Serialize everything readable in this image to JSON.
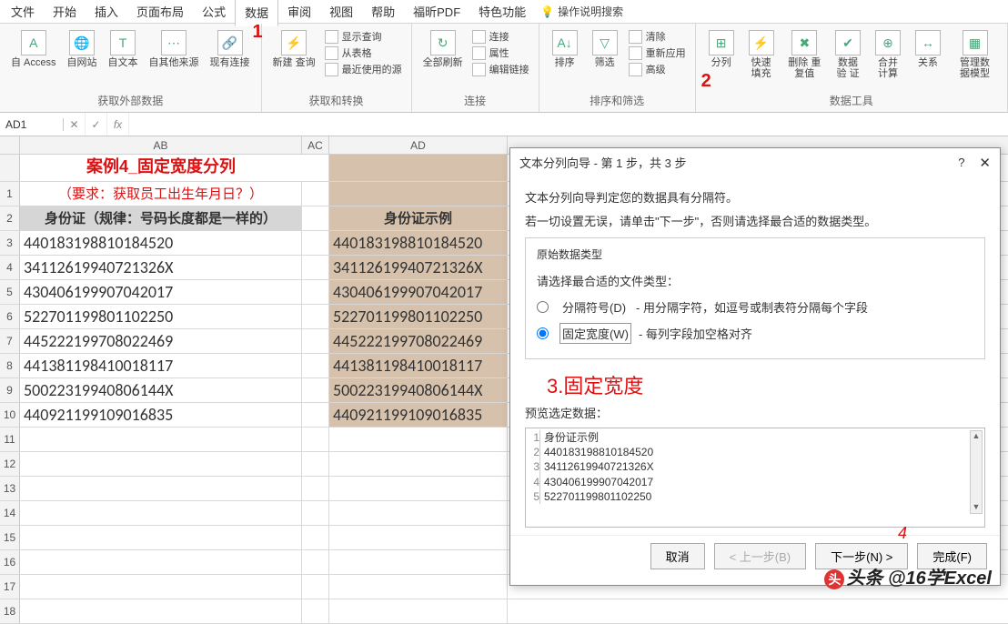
{
  "tabs": [
    "文件",
    "开始",
    "插入",
    "页面布局",
    "公式",
    "数据",
    "审阅",
    "视图",
    "帮助",
    "福昕PDF",
    "特色功能"
  ],
  "active_tab_index": 5,
  "search_help": "操作说明搜索",
  "ribbon": {
    "groups": [
      {
        "label": "获取外部数据",
        "big": [
          {
            "icon": "A",
            "name": "自 Access"
          },
          {
            "icon": "🌐",
            "name": "自网站"
          },
          {
            "icon": "T",
            "name": "自文本"
          },
          {
            "icon": "⋯",
            "name": "自其他来源"
          },
          {
            "icon": "🔗",
            "name": "现有连接"
          }
        ]
      },
      {
        "label": "获取和转换",
        "annotation": "1",
        "big": [
          {
            "icon": "⚡",
            "name": "新建\n查询"
          }
        ],
        "lines": [
          "显示查询",
          "从表格",
          "最近使用的源"
        ]
      },
      {
        "label": "连接",
        "big": [
          {
            "icon": "↻",
            "name": "全部刷新"
          }
        ],
        "lines": [
          "连接",
          "属性",
          "编辑链接"
        ]
      },
      {
        "label": "排序和筛选",
        "big": [
          {
            "icon": "A↓",
            "name": "排序"
          },
          {
            "icon": "▽",
            "name": "筛选"
          }
        ],
        "lines": [
          "清除",
          "重新应用",
          "高级"
        ]
      },
      {
        "label": "数据工具",
        "annotation": "2",
        "big": [
          {
            "icon": "⊞",
            "name": "分列"
          },
          {
            "icon": "⚡",
            "name": "快速填充"
          },
          {
            "icon": "✖",
            "name": "删除\n重复值"
          },
          {
            "icon": "✔",
            "name": "数据验\n证"
          },
          {
            "icon": "⊕",
            "name": "合并计算"
          },
          {
            "icon": "↔",
            "name": "关系"
          },
          {
            "icon": "▦",
            "name": "管理数\n据模型"
          }
        ]
      }
    ]
  },
  "formula": {
    "name_box": "AD1",
    "value": ""
  },
  "columns": [
    "AB",
    "AC",
    "AD"
  ],
  "sheet": {
    "title": "案例4_固定宽度分列",
    "subtitle": "（要求：获取员工出生年月日？）",
    "hdr_ab": "身份证（规律：号码长度都是一样的）",
    "hdr_ad": "身份证示例",
    "ids": [
      "440183198810184520",
      "34112619940721326X",
      "430406199907042017",
      "522701199801102250",
      "445222199708022469",
      "441381198410018117",
      "50022319940806144X",
      "440921199109016835"
    ]
  },
  "dialog": {
    "title": "文本分列向导 - 第 1 步，共 3 步",
    "line1": "文本分列向导判定您的数据具有分隔符。",
    "line2": "若一切设置无误，请单击\"下一步\"，否则请选择最合适的数据类型。",
    "fieldset_title": "原始数据类型",
    "fieldset_sub": "请选择最合适的文件类型：",
    "radio1_label": "分隔符号(D)",
    "radio1_desc": "- 用分隔字符，如逗号或制表符分隔每个字段",
    "radio2_label": "固定宽度(W)",
    "radio2_desc": "- 每列字段加空格对齐",
    "annotation": "3.固定宽度",
    "preview_label": "预览选定数据：",
    "preview_lines": [
      "身份证示例",
      "440183198810184520",
      "34112619940721326X",
      "430406199907042017",
      "522701199801102250"
    ],
    "buttons": {
      "cancel": "取消",
      "back": "< 上一步(B)",
      "next": "下一步(N) >",
      "finish": "完成(F)"
    },
    "anno4": "4"
  },
  "watermark": "头条 @16学Excel"
}
